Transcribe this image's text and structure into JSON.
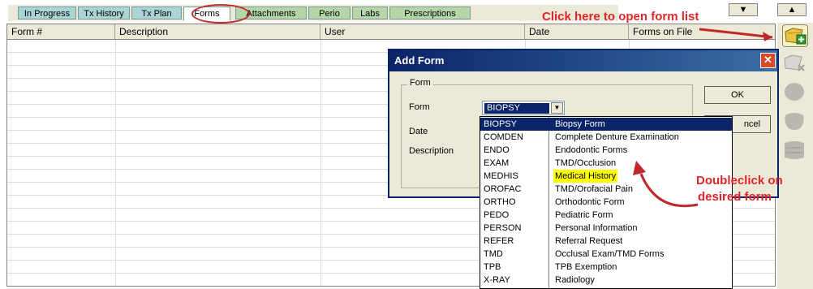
{
  "tabs": [
    {
      "label": "In Progress",
      "color": "c1"
    },
    {
      "label": "Tx History",
      "color": "c1"
    },
    {
      "label": "Tx Plan",
      "color": "c1"
    },
    {
      "label": "Forms",
      "color": "c1",
      "active": true
    },
    {
      "label": "Attachments",
      "color": "c2"
    },
    {
      "label": "Perio",
      "color": "c2"
    },
    {
      "label": "Labs",
      "color": "c2"
    },
    {
      "label": "Prescriptions",
      "color": "c2"
    }
  ],
  "grid": {
    "columns": [
      "Form #",
      "Description",
      "User",
      "Date"
    ],
    "forms_on_file_label": "Forms on File"
  },
  "dialog": {
    "title": "Add Form",
    "close_glyph": "✕",
    "group_label": "Form",
    "form_label": "Form",
    "date_label": "Date",
    "description_label": "Description",
    "selected_form": "BIOPSY",
    "ok_label": "OK",
    "cancel_label": "ncel"
  },
  "form_list": [
    {
      "code": "BIOPSY",
      "name": "Biopsy Form",
      "selected": true
    },
    {
      "code": "COMDEN",
      "name": "Complete Denture Examination"
    },
    {
      "code": "ENDO",
      "name": "Endodontic Forms"
    },
    {
      "code": "EXAM",
      "name": "TMD/Occlusion"
    },
    {
      "code": "MEDHIS",
      "name": "Medical History",
      "highlighted": true
    },
    {
      "code": "OROFAC",
      "name": "TMD/Orofacial Pain"
    },
    {
      "code": "ORTHO",
      "name": "Orthodontic Form"
    },
    {
      "code": "PEDO",
      "name": "Pediatric Form"
    },
    {
      "code": "PERSON",
      "name": "Personal Information"
    },
    {
      "code": "REFER",
      "name": "Referral Request"
    },
    {
      "code": "TMD",
      "name": "Occlusal Exam/TMD Forms"
    },
    {
      "code": "TPB",
      "name": "TPB Exemption"
    },
    {
      "code": "X-RAY",
      "name": "Radiology"
    }
  ],
  "annotations": {
    "open_list": "Click here to open form list",
    "doubleclick_line1": "Doubleclick on",
    "doubleclick_line2": "desired form"
  },
  "colors": {
    "annotation": "#e0252a",
    "selection": "#0a246a",
    "highlight": "#ffff00"
  }
}
